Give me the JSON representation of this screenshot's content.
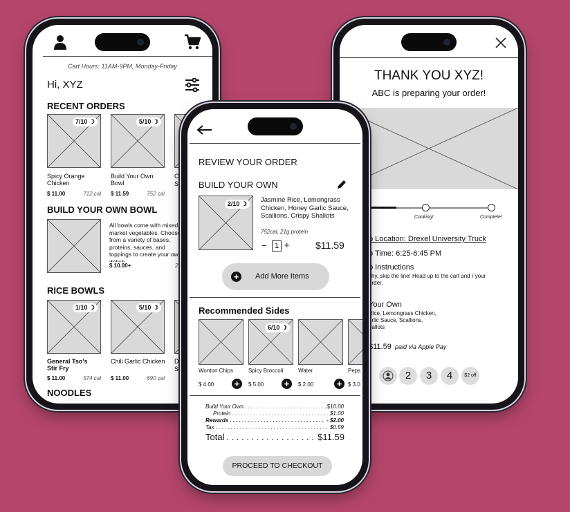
{
  "left": {
    "cart_hours": "Cart Hours: 11AM-9PM, Monday-Friday",
    "greeting": "Hi, XYZ",
    "recent_title": "RECENT ORDERS",
    "recent": [
      {
        "badge": "7/10",
        "name": "Spicy Orange Chicken",
        "price": "$ 11.00",
        "cal": "712 cal"
      },
      {
        "badge": "5/10",
        "name": "Build Your Own Bowl",
        "price": "$ 11.59",
        "cal": "752 cal"
      },
      {
        "badge": "",
        "name": "C... S...",
        "price": "",
        "cal": ""
      }
    ],
    "byo_title": "BUILD YOUR OWN BOWL",
    "byo_desc": "All bowls come with mixed market vegetables. Choose from a variety of bases, proteins, sauces, and toppings to create your own delish...",
    "byo_price": "$ 10.00+",
    "byo_extra": "2",
    "rice_title": "RICE BOWLS",
    "rice": [
      {
        "badge": "1/10",
        "name": "General Tso's Stir Fry",
        "price": "$ 11.00",
        "cal": "574 cal"
      },
      {
        "badge": "5/10",
        "name": "Chili Garlic Chicken",
        "price": "$ 11.00",
        "cal": "690 cal"
      },
      {
        "badge": "",
        "name": "D... S...",
        "price": "",
        "cal": ""
      }
    ],
    "noodles_title": "NOODLES"
  },
  "center": {
    "title": "REVIEW YOUR ORDER",
    "item_title": "BUILD YOUR OWN",
    "item_badge": "2/10",
    "item_desc": "Jasmine Rice, Lemongrass Chicken, Honey Garlic Sauce, Scallions, Crispy Shallots",
    "item_meta": "752cal, 21g protein",
    "qty_minus": "−",
    "qty": "1",
    "qty_plus": "+",
    "item_price": "$11.59",
    "add_more": "Add More Items",
    "rec_title": "Recommended Sides",
    "sides": [
      {
        "name": "Wonton Chips",
        "price": "$ 4.00",
        "badge": ""
      },
      {
        "name": "Spicy Broccoli",
        "price": "$ 5.00",
        "badge": "6/10"
      },
      {
        "name": "Water",
        "price": "$ 2.00",
        "badge": ""
      },
      {
        "name": "Peps",
        "price": "$ 3.0",
        "badge": ""
      }
    ],
    "summary": [
      {
        "label": "Build Your Own",
        "value": "$10.00",
        "indent": false,
        "bold": false
      },
      {
        "label": "Protein",
        "value": "$1.00",
        "indent": true,
        "bold": false
      },
      {
        "label": "Rewards",
        "value": "- $2.00",
        "indent": false,
        "bold": true
      },
      {
        "label": "Tax",
        "value": "$0.59",
        "indent": false,
        "bold": false
      }
    ],
    "total_label": "Total",
    "total_value": "$11.59",
    "checkout": "PROCEED TO CHECKOUT"
  },
  "right": {
    "thanks": "THANK YOU XYZ!",
    "preparing": "ABC is preparing your order!",
    "stage_cooking": "Cooking!",
    "stage_complete": "Complete!",
    "pickup_location": "p Location: Drexel University Truck",
    "pickup_time": "p Time: 6:25-6:45 PM",
    "instructions_title": "p Instructions",
    "instructions_body": "shy, skip the line! Head up to the cart and r your order.",
    "order_title": "Your Own",
    "order_body": "Rice, Lemongrass Chicken, arlic Sauce, Scallions, hallots",
    "paid_amount": "$11.59",
    "paid_via": "paid via Apple Pay",
    "steps": [
      "2",
      "3",
      "4"
    ],
    "off": "$2 off"
  },
  "colors": {
    "background": "#b5466b",
    "placeholder": "#d9d9d9",
    "button": "#d8d8d8"
  }
}
